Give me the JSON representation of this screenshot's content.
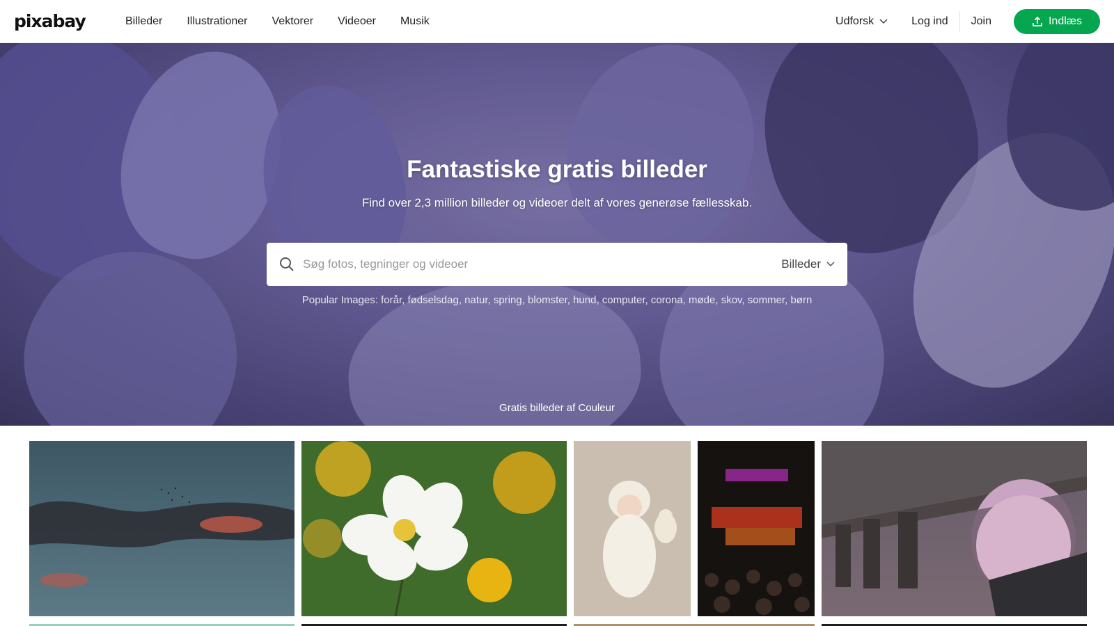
{
  "header": {
    "logo": "pixabay",
    "nav": [
      "Billeder",
      "Illustrationer",
      "Vektorer",
      "Videoer",
      "Musik"
    ],
    "explore_label": "Udforsk",
    "login_label": "Log ind",
    "join_label": "Join",
    "upload_label": "Indlæs"
  },
  "hero": {
    "title": "Fantastiske gratis billeder",
    "subtitle": "Find over 2,3 million billeder og videoer delt af vores generøse fællesskab.",
    "search_placeholder": "Søg fotos, tegninger og videoer",
    "search_type": "Billeder",
    "popular": "Popular Images: forår, fødselsdag, natur, spring, blomster, hund, computer, corona, møde, skov, sommer, børn",
    "credit": "Gratis billeder af Couleur"
  },
  "colors": {
    "accent": "#05a650"
  },
  "icons": {
    "search": "search-icon",
    "chevron": "chevron-down-icon",
    "upload": "upload-icon"
  }
}
